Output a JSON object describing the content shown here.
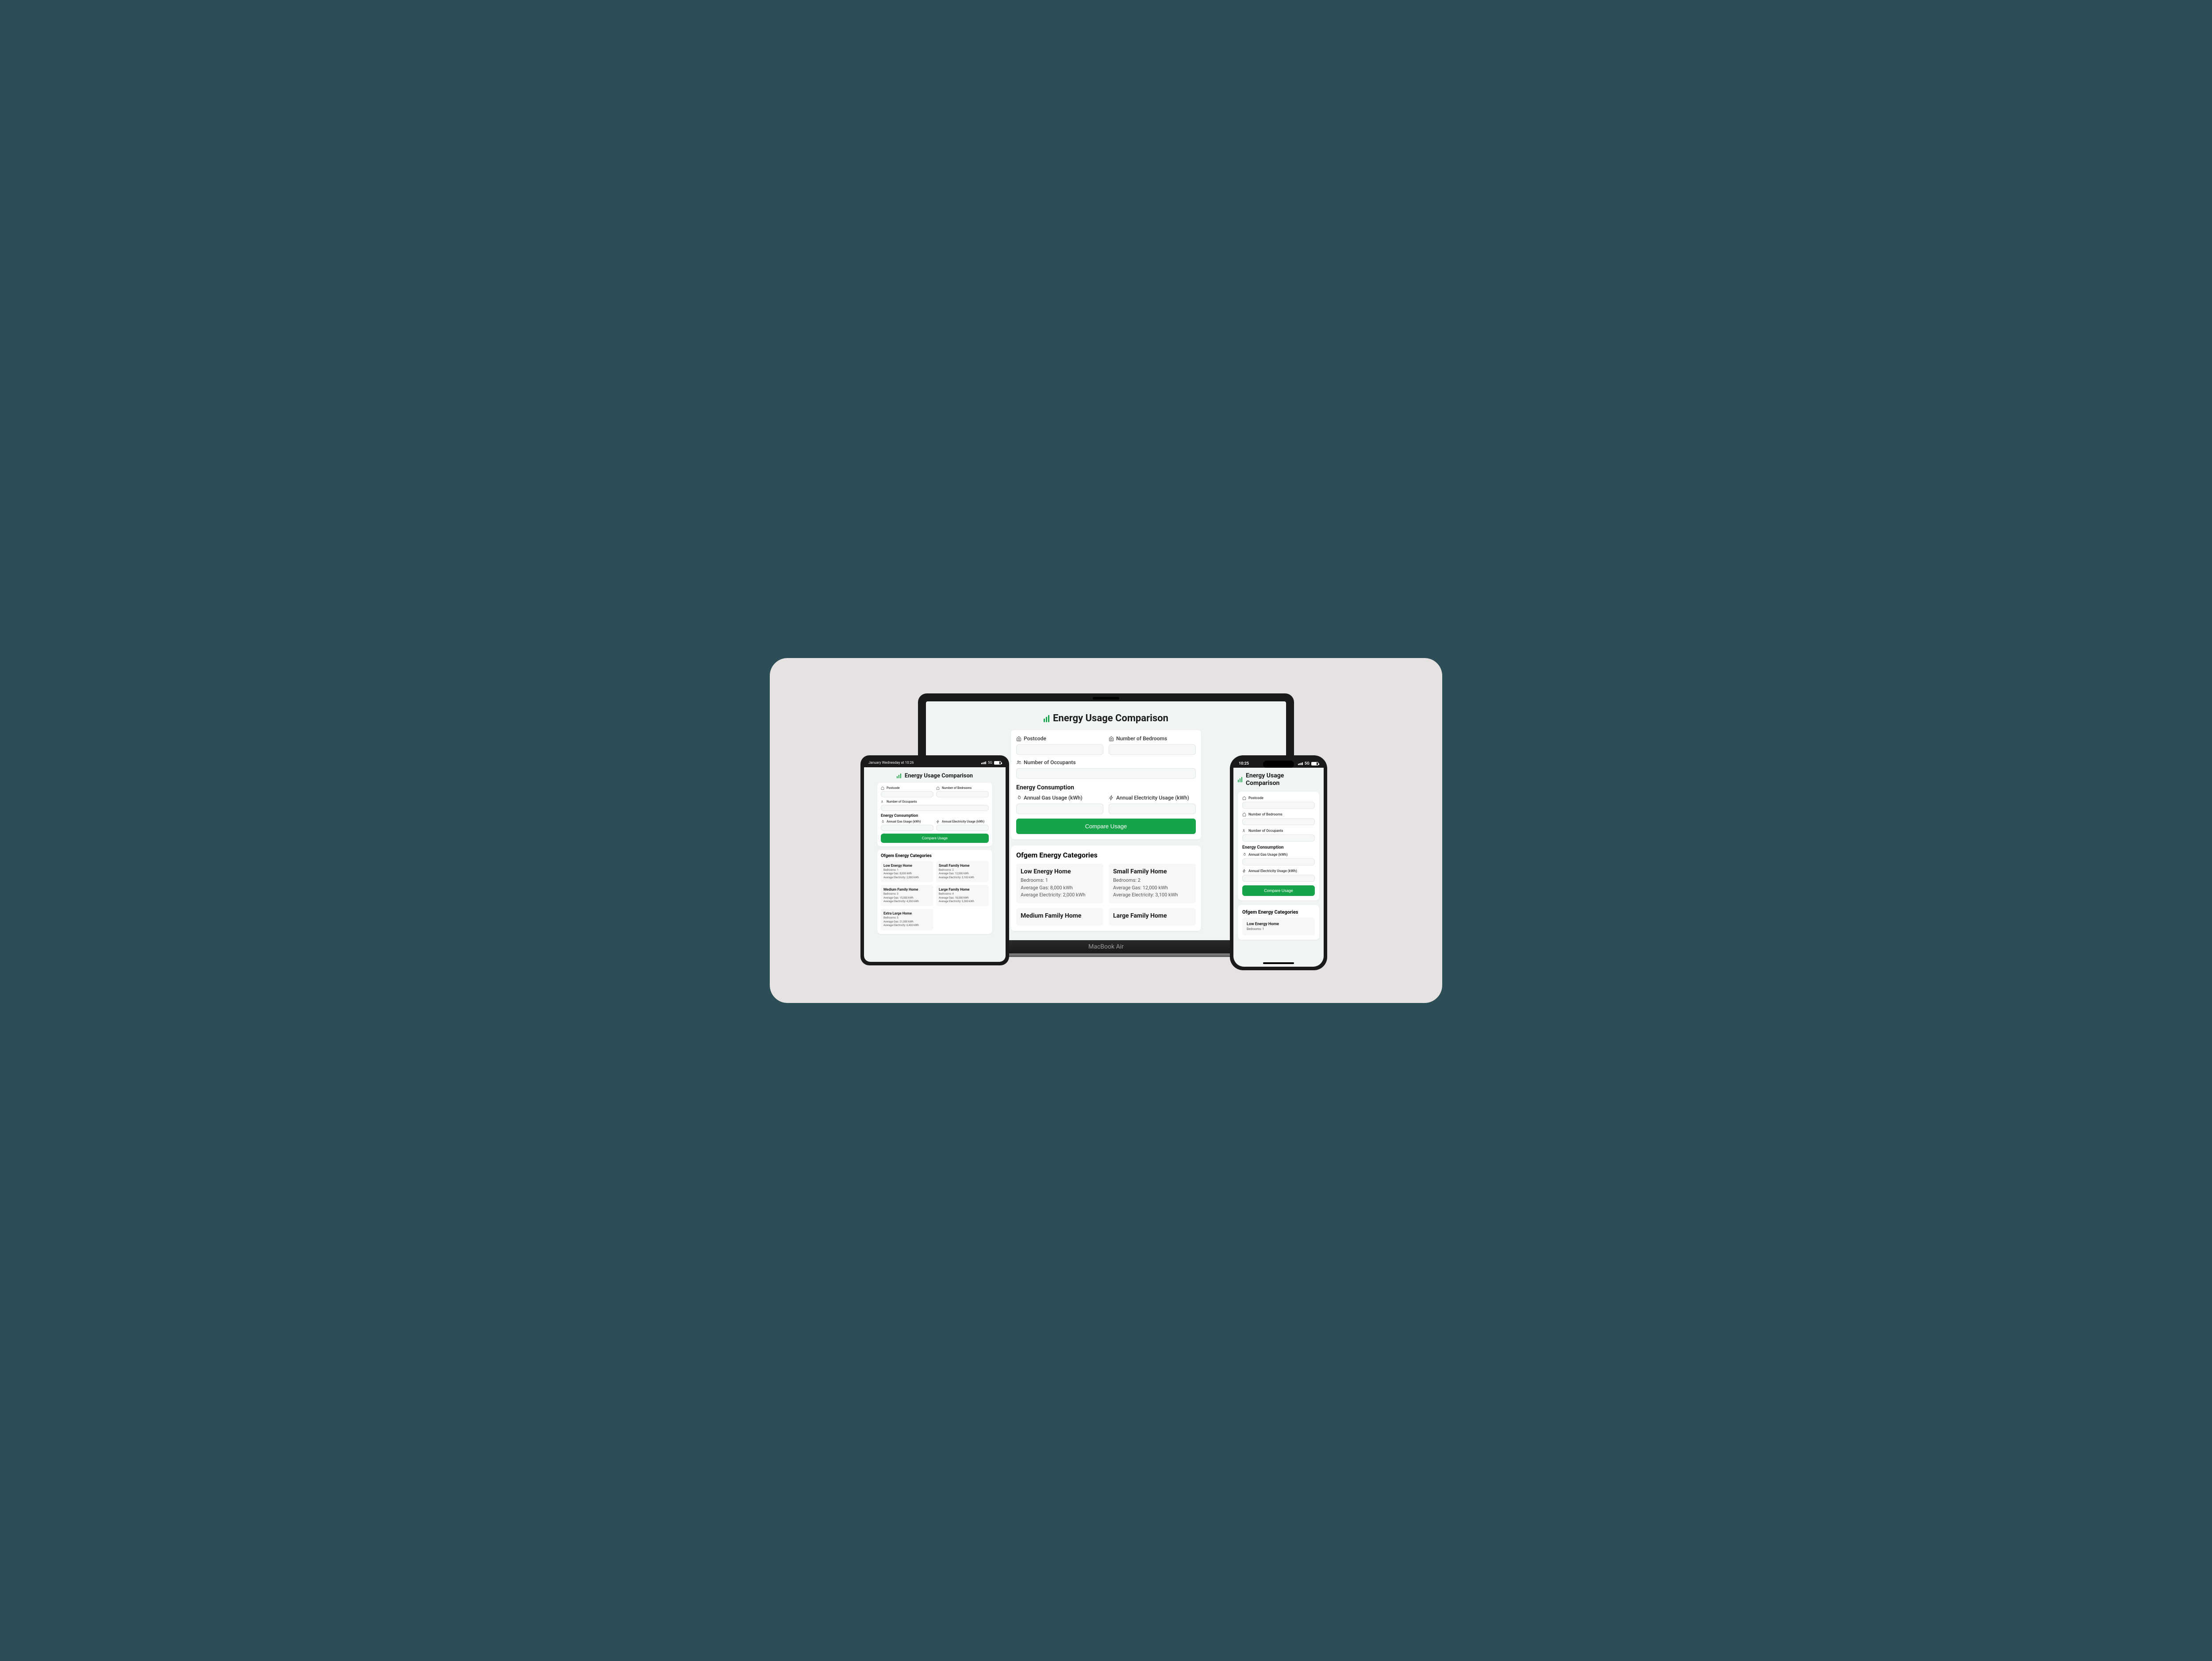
{
  "app": {
    "title": "Energy Usage Comparison",
    "form": {
      "postcode_label": "Postcode",
      "bedrooms_label": "Number of Bedrooms",
      "occupants_label": "Number of Occupants",
      "consumption_heading": "Energy Consumption",
      "gas_label": "Annual Gas Usage (kWh)",
      "elec_label": "Annual Electricity Usage (kWh)",
      "submit_label": "Compare Usage"
    },
    "categories_heading": "Ofgem Energy Categories",
    "categories": [
      {
        "title": "Low Energy Home",
        "bedrooms": "Bedrooms: 1",
        "gas": "Average Gas: 8,000 kWh",
        "elec": "Average Electricity: 2,000 kWh"
      },
      {
        "title": "Small Family Home",
        "bedrooms": "Bedrooms: 2",
        "gas": "Average Gas: 12,000 kWh",
        "elec": "Average Electricity: 3,100 kWh"
      },
      {
        "title": "Medium Family Home",
        "bedrooms": "Bedrooms: 3",
        "gas": "Average Gas: 15,000 kWh",
        "elec": "Average Electricity: 4,200 kWh"
      },
      {
        "title": "Large Family Home",
        "bedrooms": "Bedrooms: 4",
        "gas": "Average Gas: 18,000 kWh",
        "elec": "Average Electricity: 5,300 kWh"
      },
      {
        "title": "Extra Large Home",
        "bedrooms": "Bedrooms: 5",
        "gas": "Average Gas: 21,000 kWh",
        "elec": "Average Electricity: 6,400 kWh"
      }
    ]
  },
  "devices": {
    "laptop_brand": "MacBook Air",
    "tablet_status_left": "January Wednesday at 10:26",
    "tablet_status_right": "5G",
    "phone_time": "10:25",
    "phone_status_right": "5G"
  }
}
